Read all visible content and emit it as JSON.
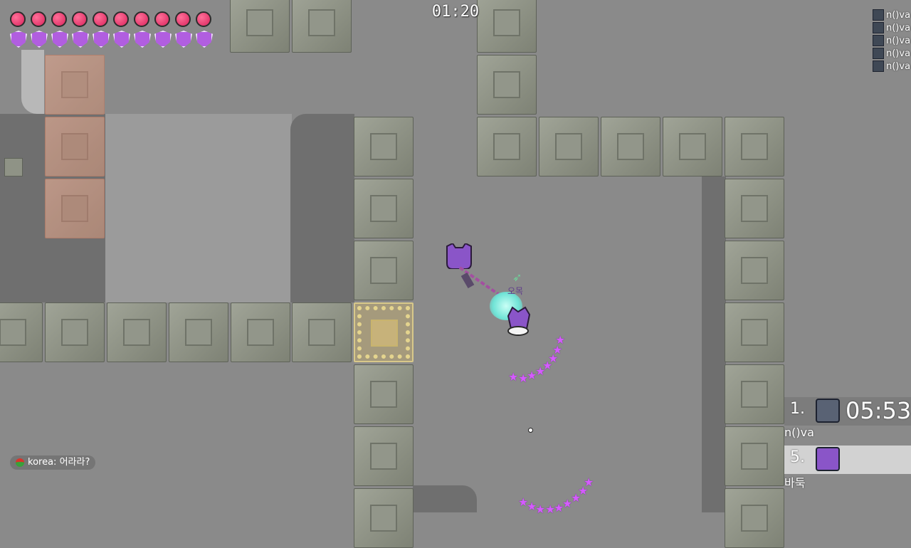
{
  "hud": {
    "timer": "01:20",
    "hearts": 10,
    "shields": 10,
    "heart_color": "#e33a6e",
    "shield_color": "#b15ee0"
  },
  "killfeed": {
    "entries": [
      "n()va",
      "n()va",
      "n()va",
      "n()va",
      "n()va"
    ]
  },
  "leaderboard": {
    "entries": [
      {
        "rank": "1.",
        "name": "n()va",
        "time": "05:53"
      },
      {
        "rank": "5.",
        "name": "바둑",
        "time": ""
      }
    ]
  },
  "players": {
    "overhead_label": "오목"
  },
  "chat": {
    "messages": [
      {
        "author": "korea",
        "text": "어라라?"
      }
    ]
  },
  "colors": {
    "floor": "#8e8e8e",
    "wall_tile": "#8f9386",
    "lava_tile": "#c99e8c",
    "gold_tile": "#d8c88a",
    "star_trail": "#d55bff",
    "player_purple": "#8a55c8",
    "impact_cyan": "#6fe3d6"
  }
}
